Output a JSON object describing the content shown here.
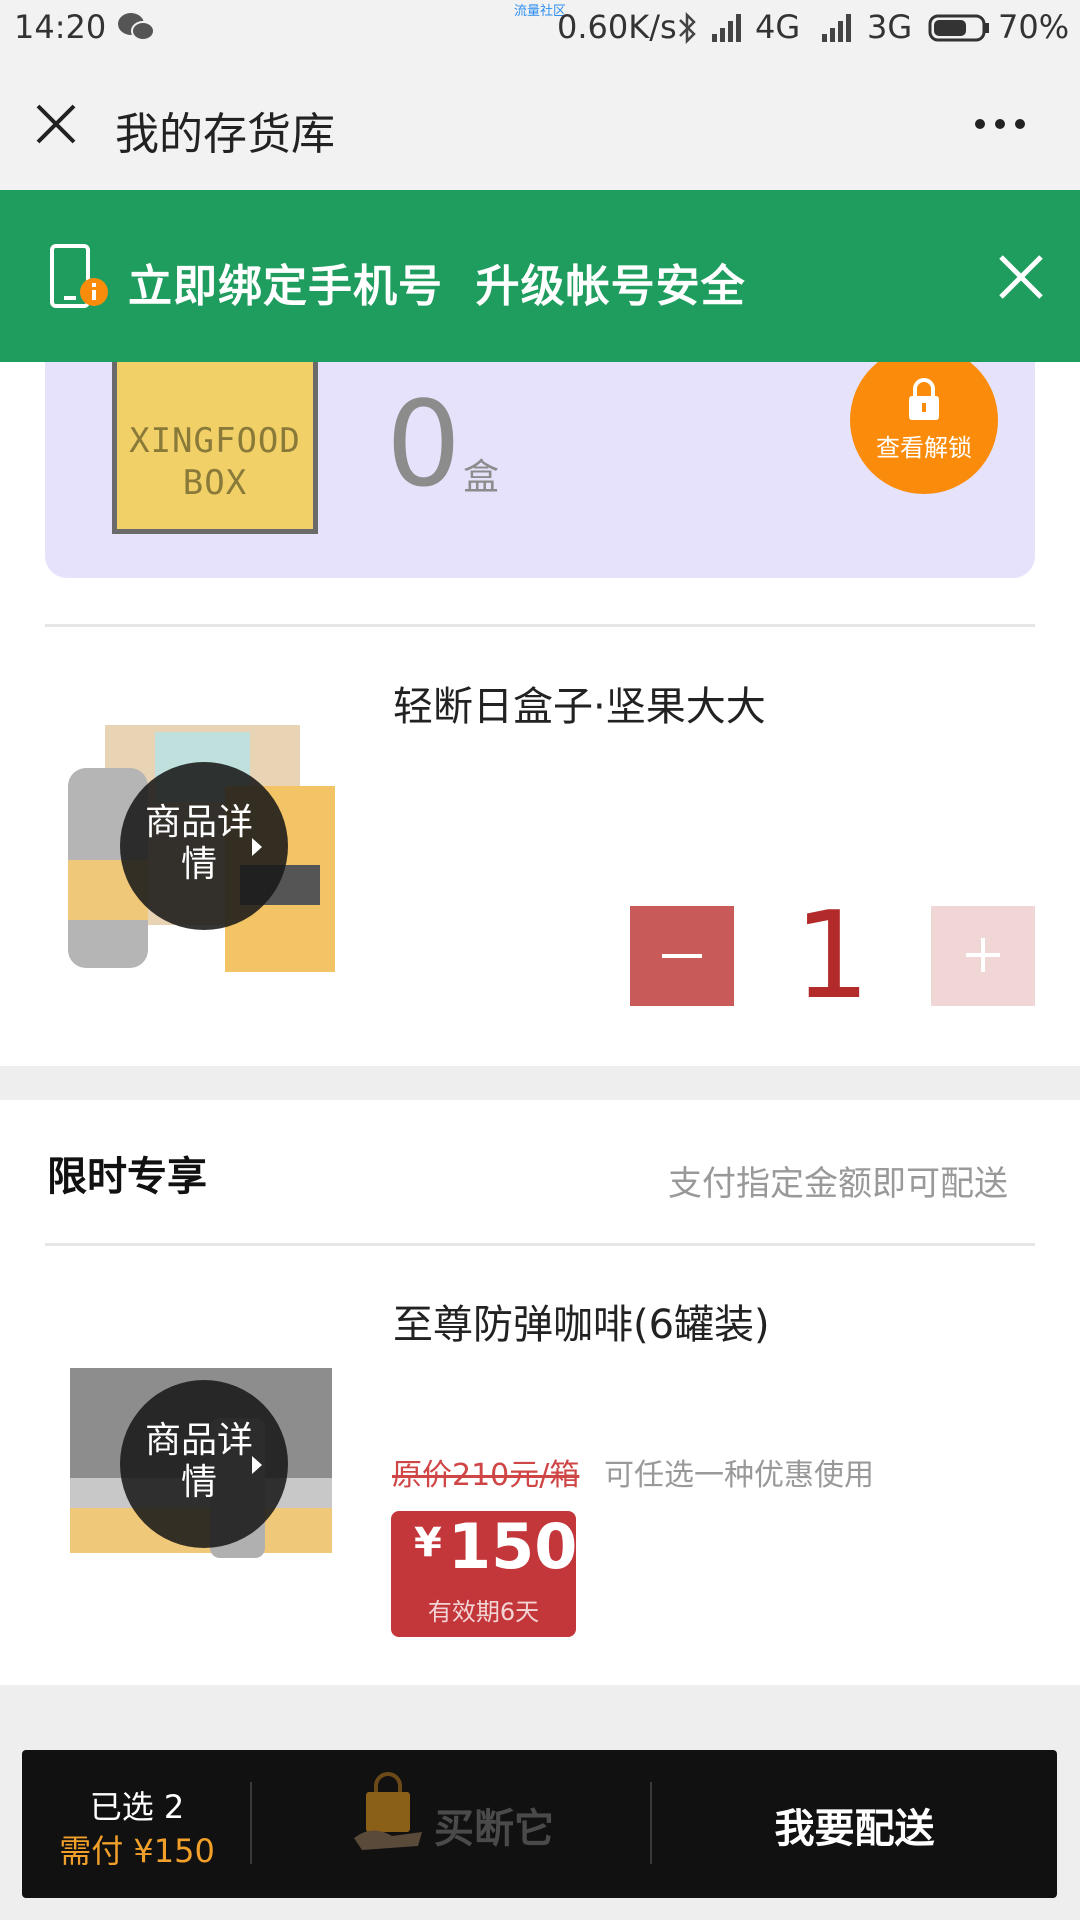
{
  "status_bar": {
    "time": "14:20",
    "center_label": "流量社区",
    "speed": "0.60K/s",
    "network1": "4G",
    "network2": "3G",
    "battery": "70%",
    "battery_level": 0.7
  },
  "nav": {
    "title": "我的存货库"
  },
  "banner": {
    "text": "立即绑定手机号  升级帐号安全"
  },
  "inventory": {
    "box_label": "XINGFOOD BOX",
    "count": "0",
    "unit": "盒",
    "unlock_label": "查看解锁"
  },
  "products": [
    {
      "title": "轻断日盒子·坚果大大",
      "detail_label": "商品详情",
      "quantity": "1",
      "minus": "−",
      "plus": "+"
    }
  ],
  "limited": {
    "title": "限时专享",
    "subtitle": "支付指定金额即可配送",
    "item": {
      "title": "至尊防弹咖啡(6罐装)",
      "detail_label": "商品详情",
      "original_price": "原价210元/箱",
      "promo_note": "可任选一种优惠使用",
      "price_symbol": "¥",
      "price": "150",
      "validity": "有效期6天"
    }
  },
  "bottom_bar": {
    "selected": "已选 2",
    "pay": "需付 ¥150",
    "buy_label": "买断它",
    "deliver_label": "我要配送"
  },
  "colors": {
    "banner_green": "#1e9d5e",
    "unlock_orange": "#fb8c0b",
    "price_red": "#c3363a"
  }
}
